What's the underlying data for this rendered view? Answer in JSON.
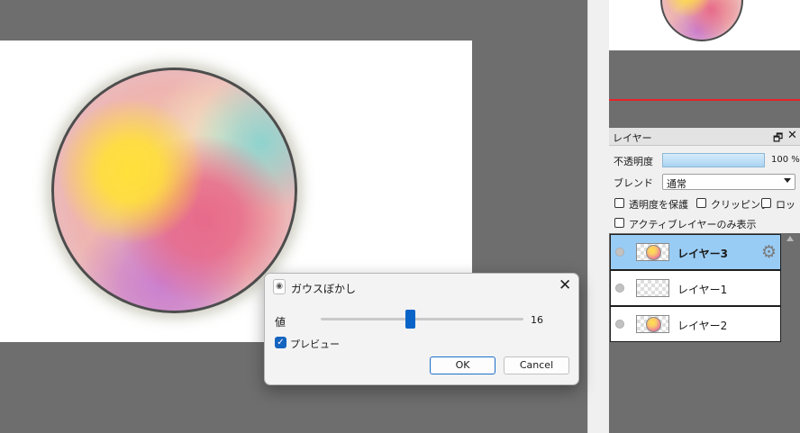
{
  "navigator": {},
  "layer_panel": {
    "title": "レイヤー",
    "restore_icon": "restore-icon",
    "close_icon": "close-icon",
    "opacity_label": "不透明度",
    "opacity_value": "100 %",
    "opacity_fraction": 1.0,
    "blend_label": "ブレンド",
    "blend_value": "通常",
    "checkbox_protect_alpha": "透明度を保護",
    "checkbox_clipping": "クリッピング",
    "checkbox_lock": "ロッ",
    "checkbox_show_active_only": "アクティブレイヤーのみ表示",
    "layers": [
      {
        "name": "レイヤー3",
        "selected": true,
        "thumb": "sphere"
      },
      {
        "name": "レイヤー1",
        "selected": false,
        "thumb": "empty"
      },
      {
        "name": "レイヤー2",
        "selected": false,
        "thumb": "sphere"
      }
    ],
    "selected_color": "#99ccf5"
  },
  "dialog": {
    "title": "ガウスぼかし",
    "value_label": "値",
    "value": "16",
    "slider_fraction": 0.44,
    "preview_label": "プレビュー",
    "preview_checked": true,
    "ok_label": "OK",
    "cancel_label": "Cancel",
    "close_glyph": "✕",
    "check_glyph": "✓"
  },
  "colors": {
    "accent": "#0a64c8",
    "nav_line": "#e8222a",
    "workspace_bg": "#6e6e6e"
  }
}
